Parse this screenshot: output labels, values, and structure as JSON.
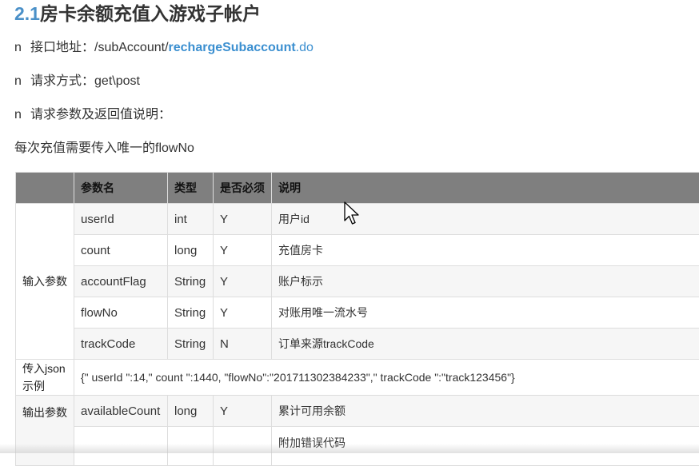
{
  "heading": {
    "number": "2.1",
    "title": "房卡余额充值入游戏子帐户"
  },
  "lines": {
    "bullet": "n",
    "api_label": "接口地址：",
    "api_prefix": "/subAccount/",
    "api_method": "rechargeSubaccount",
    "api_ext": ".do",
    "method_label": "请求方式：",
    "method_value": "get\\post",
    "params_desc": "请求参数及返回值说明：",
    "note": "每次充值需要传入唯一的flowNo"
  },
  "table": {
    "headers": [
      "",
      "参数名",
      "类型",
      "是否必须",
      "说明"
    ],
    "input_group_label": "输入参数",
    "input_rows": [
      {
        "name": "userId",
        "type": "int",
        "required": "Y",
        "desc": "用户id"
      },
      {
        "name": "count",
        "type": "long",
        "required": "Y",
        "desc": "充值房卡"
      },
      {
        "name": "accountFlag",
        "type": "String",
        "required": "Y",
        "desc": "账户标示"
      },
      {
        "name": "flowNo",
        "type": "String",
        "required": "Y",
        "desc": "对账用唯一流水号"
      },
      {
        "name": "trackCode",
        "type": "String",
        "required": "N",
        "desc": "订单来源trackCode"
      }
    ],
    "json_label_line1": "传入json",
    "json_label_line2": "示例",
    "json_example": "{\" userId \":14,\" count \":1440, \"flowNo\":\"201711302384233\",\" trackCode \":\"track123456\"}",
    "output_group_label": "输出参数",
    "output_rows": [
      {
        "name": "availableCount",
        "type": "long",
        "required": "Y",
        "desc": "累计可用余额"
      },
      {
        "name": "",
        "type": "",
        "required": "",
        "desc": "附加错误代码"
      }
    ]
  },
  "icons": {
    "cursor": "mouse-pointer-icon"
  },
  "colors": {
    "accent": "#3b8fd0",
    "header_bg": "#7f7f7f",
    "row_alt": "#f6f6f6"
  }
}
